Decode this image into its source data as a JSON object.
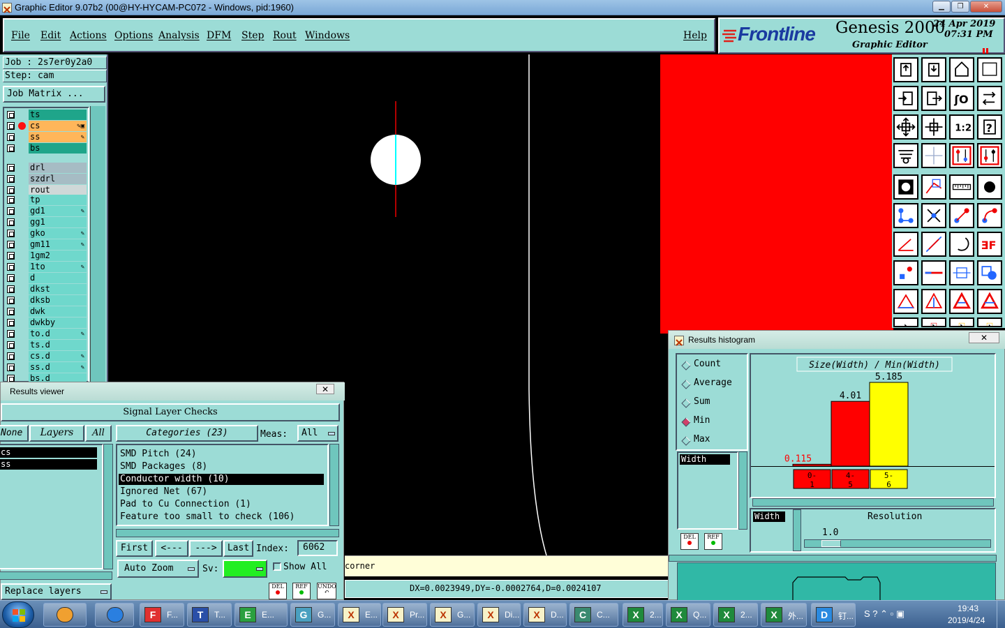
{
  "window": {
    "title": "Graphic Editor 9.07b2 (00@HY-HYCAM-PC072 - Windows, pid:1960)"
  },
  "menu": [
    "File",
    "Edit",
    "Actions",
    "Options",
    "Analysis",
    "DFM",
    "Step",
    "Rout",
    "Windows"
  ],
  "help": "Help",
  "brand": {
    "logo": "Frontline",
    "product": "Genesis 2000",
    "subtitle": "Graphic Editor",
    "date": "24 Apr 2019",
    "time": "07:31 PM"
  },
  "job": {
    "label": "Job : 2s7er0y2a0",
    "step": "Step: cam",
    "matrix_button": "Job Matrix ..."
  },
  "layers": {
    "group1": [
      {
        "name": "ts",
        "color": "#1fa58a"
      },
      {
        "name": "cs",
        "color": "#ffb65a"
      },
      {
        "name": "ss",
        "color": "#ffb65a"
      },
      {
        "name": "bs",
        "color": "#1fa58a"
      }
    ],
    "group2": [
      {
        "name": "drl",
        "color": "#a6bcc4"
      },
      {
        "name": "szdrl",
        "color": "#a6bcc4"
      },
      {
        "name": "rout",
        "color": "#cfd8d8"
      }
    ],
    "group3": [
      "tp",
      "gd1",
      "gg1",
      "gko",
      "gm11",
      "1gm2",
      "1to",
      "d",
      "dkst",
      "dksb",
      "dwk",
      "dwkby",
      "to.d",
      "ts.d",
      "cs.d",
      "ss.d",
      "bs.d"
    ]
  },
  "status": {
    "message": "corner",
    "coords": "DX=0.0023949,DY=-0.0002764,D=0.0024107"
  },
  "results_viewer": {
    "title": "Results viewer",
    "header": "Signal Layer Checks",
    "none_btn": "None",
    "layers_btn": "Layers",
    "all_btn": "All",
    "layer_list": [
      "cs",
      "ss"
    ],
    "categories_btn": "Categories (23)",
    "meas_label": "Meas:",
    "meas_value": "All",
    "categories": [
      "SMD Pitch (24)",
      "SMD Packages (8)",
      "Conductor width (10)",
      "Ignored Net (67)",
      "Pad to Cu Connection (1)",
      "Feature too small to check (106)"
    ],
    "selected_category": "Conductor width (10)",
    "nav": {
      "first": "First",
      "prev": "<---",
      "next": "--->",
      "last": "Last",
      "index_label": "Index:",
      "index_value": "6062"
    },
    "auto_zoom": "Auto Zoom",
    "sv_label": "Sv:",
    "show_all": "Show All",
    "replace_layers": "Replace layers",
    "del": "DEL",
    "ref": "REF",
    "undo": "UNDO"
  },
  "histogram": {
    "title": "Results histogram",
    "options": [
      "Count",
      "Average",
      "Sum",
      "Min",
      "Max"
    ],
    "selected": "Min",
    "list": [
      "Width"
    ],
    "chart_title": "Size(Width) / Min(Width)",
    "resolution_label": "Resolution",
    "resolution_value": "1.0",
    "width_label": "Width",
    "del": "DEL",
    "ref": "REF"
  },
  "chart_data": {
    "type": "bar",
    "title": "Size(Width) / Min(Width)",
    "categories": [
      "0-1",
      "4-5",
      "5-6"
    ],
    "values": [
      0.115,
      4.01,
      5.185
    ],
    "colors": [
      "#ff0000",
      "#ff0000",
      "#ffff00"
    ],
    "ylim": [
      0,
      5.185
    ]
  },
  "taskbar": {
    "items": [
      {
        "label": "F...",
        "icon": "F"
      },
      {
        "label": "T...",
        "icon": "T"
      },
      {
        "label": "E...",
        "icon": "E"
      },
      {
        "label": "G...",
        "icon": "G"
      },
      {
        "label": "E...",
        "icon": "X"
      },
      {
        "label": "Pr...",
        "icon": "X"
      },
      {
        "label": "G...",
        "icon": "X"
      },
      {
        "label": "Di...",
        "icon": "X"
      },
      {
        "label": "D...",
        "icon": "X"
      },
      {
        "label": "C...",
        "icon": "C"
      },
      {
        "label": "2...",
        "icon": "x"
      },
      {
        "label": "Q...",
        "icon": "x"
      },
      {
        "label": "2...",
        "icon": "x"
      },
      {
        "label": "外...",
        "icon": "x"
      },
      {
        "label": "钉...",
        "icon": "d"
      }
    ],
    "clock_time": "19:43",
    "clock_date": "2019/4/24"
  }
}
